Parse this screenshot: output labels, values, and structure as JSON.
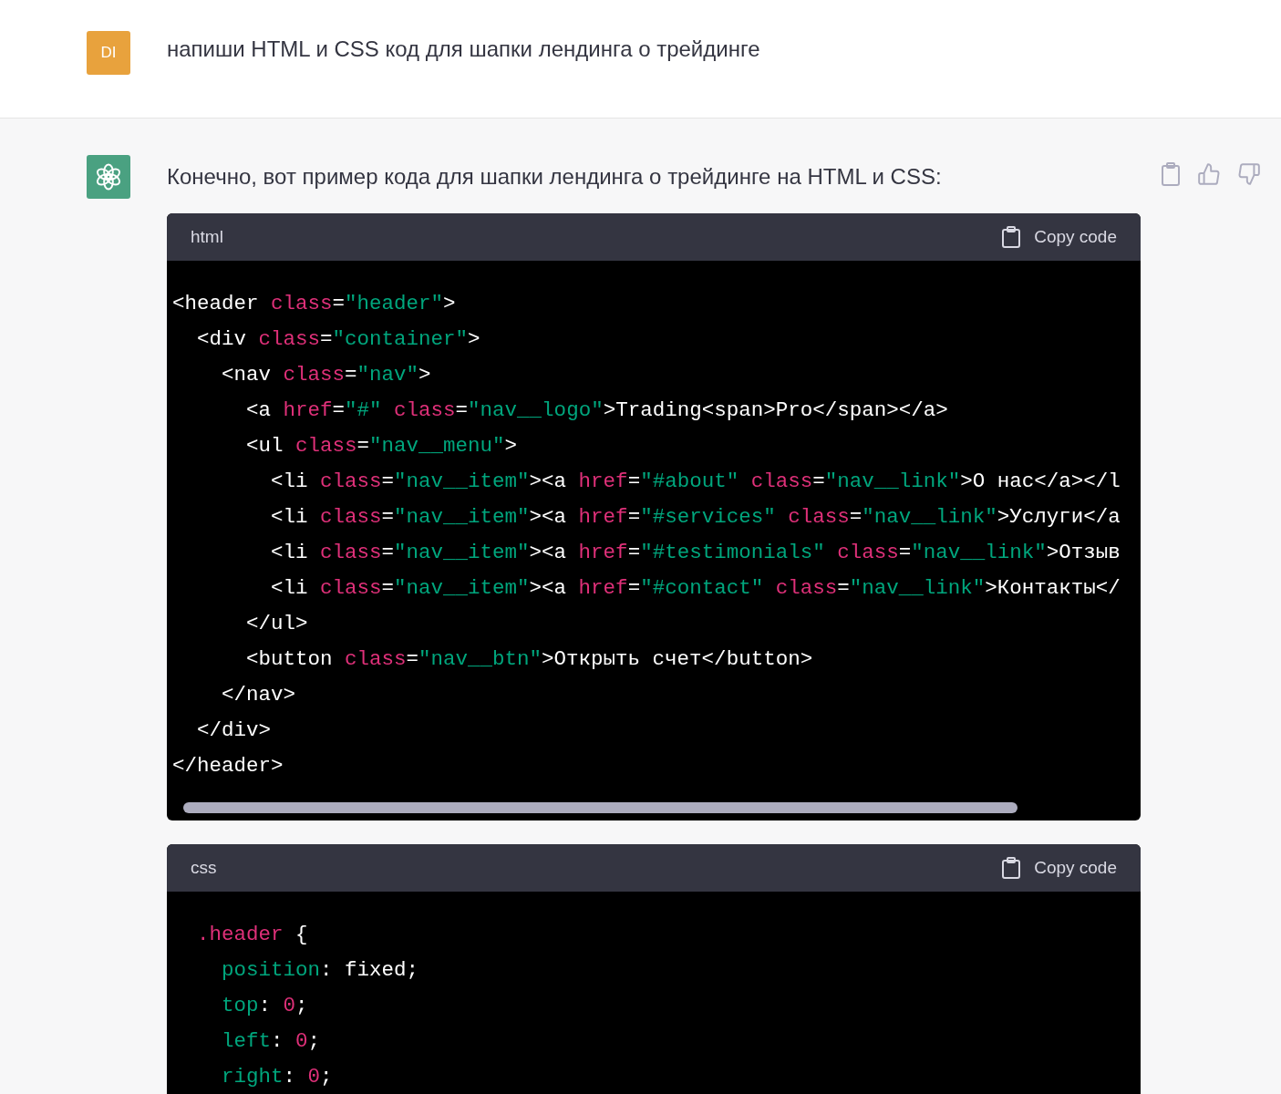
{
  "user_message": {
    "avatar_initials": "DI",
    "text": "напиши HTML и CSS код для шапки лендинга о трейдинге"
  },
  "assistant_message": {
    "text": "Конечно, вот пример кода для шапки лендинга о трейдинге на HTML и CSS:",
    "code_blocks": [
      {
        "language": "html",
        "copy_label": "Copy code",
        "lines": [
          [
            {
              "kind": "tag",
              "text": "<header "
            },
            {
              "kind": "attr",
              "text": "class"
            },
            {
              "kind": "tag",
              "text": "="
            },
            {
              "kind": "string",
              "text": "\"header\""
            },
            {
              "kind": "tag",
              "text": ">"
            }
          ],
          [
            {
              "kind": "tag",
              "text": "  <div "
            },
            {
              "kind": "attr",
              "text": "class"
            },
            {
              "kind": "tag",
              "text": "="
            },
            {
              "kind": "string",
              "text": "\"container\""
            },
            {
              "kind": "tag",
              "text": ">"
            }
          ],
          [
            {
              "kind": "tag",
              "text": "    <nav "
            },
            {
              "kind": "attr",
              "text": "class"
            },
            {
              "kind": "tag",
              "text": "="
            },
            {
              "kind": "string",
              "text": "\"nav\""
            },
            {
              "kind": "tag",
              "text": ">"
            }
          ],
          [
            {
              "kind": "tag",
              "text": "      <a "
            },
            {
              "kind": "attr",
              "text": "href"
            },
            {
              "kind": "tag",
              "text": "="
            },
            {
              "kind": "string",
              "text": "\"#\" "
            },
            {
              "kind": "attr",
              "text": "class"
            },
            {
              "kind": "tag",
              "text": "="
            },
            {
              "kind": "string",
              "text": "\"nav__logo\""
            },
            {
              "kind": "tag",
              "text": ">Trading<span>Pro</span></a>"
            }
          ],
          [
            {
              "kind": "tag",
              "text": "      <ul "
            },
            {
              "kind": "attr",
              "text": "class"
            },
            {
              "kind": "tag",
              "text": "="
            },
            {
              "kind": "string",
              "text": "\"nav__menu\""
            },
            {
              "kind": "tag",
              "text": ">"
            }
          ],
          [
            {
              "kind": "tag",
              "text": "        <li "
            },
            {
              "kind": "attr",
              "text": "class"
            },
            {
              "kind": "tag",
              "text": "="
            },
            {
              "kind": "string",
              "text": "\"nav__item\""
            },
            {
              "kind": "tag",
              "text": "><a "
            },
            {
              "kind": "attr",
              "text": "href"
            },
            {
              "kind": "tag",
              "text": "="
            },
            {
              "kind": "string",
              "text": "\"#about\" "
            },
            {
              "kind": "attr",
              "text": "class"
            },
            {
              "kind": "tag",
              "text": "="
            },
            {
              "kind": "string",
              "text": "\"nav__link\""
            },
            {
              "kind": "tag",
              "text": ">О нас</a></l"
            }
          ],
          [
            {
              "kind": "tag",
              "text": "        <li "
            },
            {
              "kind": "attr",
              "text": "class"
            },
            {
              "kind": "tag",
              "text": "="
            },
            {
              "kind": "string",
              "text": "\"nav__item\""
            },
            {
              "kind": "tag",
              "text": "><a "
            },
            {
              "kind": "attr",
              "text": "href"
            },
            {
              "kind": "tag",
              "text": "="
            },
            {
              "kind": "string",
              "text": "\"#services\" "
            },
            {
              "kind": "attr",
              "text": "class"
            },
            {
              "kind": "tag",
              "text": "="
            },
            {
              "kind": "string",
              "text": "\"nav__link\""
            },
            {
              "kind": "tag",
              "text": ">Услуги</a"
            }
          ],
          [
            {
              "kind": "tag",
              "text": "        <li "
            },
            {
              "kind": "attr",
              "text": "class"
            },
            {
              "kind": "tag",
              "text": "="
            },
            {
              "kind": "string",
              "text": "\"nav__item\""
            },
            {
              "kind": "tag",
              "text": "><a "
            },
            {
              "kind": "attr",
              "text": "href"
            },
            {
              "kind": "tag",
              "text": "="
            },
            {
              "kind": "string",
              "text": "\"#testimonials\" "
            },
            {
              "kind": "attr",
              "text": "class"
            },
            {
              "kind": "tag",
              "text": "="
            },
            {
              "kind": "string",
              "text": "\"nav__link\""
            },
            {
              "kind": "tag",
              "text": ">Отзыв"
            }
          ],
          [
            {
              "kind": "tag",
              "text": "        <li "
            },
            {
              "kind": "attr",
              "text": "class"
            },
            {
              "kind": "tag",
              "text": "="
            },
            {
              "kind": "string",
              "text": "\"nav__item\""
            },
            {
              "kind": "tag",
              "text": "><a "
            },
            {
              "kind": "attr",
              "text": "href"
            },
            {
              "kind": "tag",
              "text": "="
            },
            {
              "kind": "string",
              "text": "\"#contact\" "
            },
            {
              "kind": "attr",
              "text": "class"
            },
            {
              "kind": "tag",
              "text": "="
            },
            {
              "kind": "string",
              "text": "\"nav__link\""
            },
            {
              "kind": "tag",
              "text": ">Контакты</"
            }
          ],
          [
            {
              "kind": "tag",
              "text": "      </ul>"
            }
          ],
          [
            {
              "kind": "tag",
              "text": "      <button "
            },
            {
              "kind": "attr",
              "text": "class"
            },
            {
              "kind": "tag",
              "text": "="
            },
            {
              "kind": "string",
              "text": "\"nav__btn\""
            },
            {
              "kind": "tag",
              "text": ">Открыть счет</button>"
            }
          ],
          [
            {
              "kind": "tag",
              "text": "    </nav>"
            }
          ],
          [
            {
              "kind": "tag",
              "text": "  </div>"
            }
          ],
          [
            {
              "kind": "tag",
              "text": "</header>"
            }
          ]
        ]
      },
      {
        "language": "css",
        "copy_label": "Copy code",
        "lines": [
          [
            {
              "kind": "attr",
              "text": "  .header"
            },
            {
              "kind": "tag",
              "text": " {"
            }
          ],
          [
            {
              "kind": "string",
              "text": "    position"
            },
            {
              "kind": "tag",
              "text": ": fixed;"
            }
          ],
          [
            {
              "kind": "string",
              "text": "    top"
            },
            {
              "kind": "tag",
              "text": ": "
            },
            {
              "kind": "attr",
              "text": "0"
            },
            {
              "kind": "tag",
              "text": ";"
            }
          ],
          [
            {
              "kind": "string",
              "text": "    left"
            },
            {
              "kind": "tag",
              "text": ": "
            },
            {
              "kind": "attr",
              "text": "0"
            },
            {
              "kind": "tag",
              "text": ";"
            }
          ],
          [
            {
              "kind": "string",
              "text": "    right"
            },
            {
              "kind": "tag",
              "text": ": "
            },
            {
              "kind": "attr",
              "text": "0"
            },
            {
              "kind": "tag",
              "text": ";"
            }
          ]
        ]
      }
    ]
  }
}
